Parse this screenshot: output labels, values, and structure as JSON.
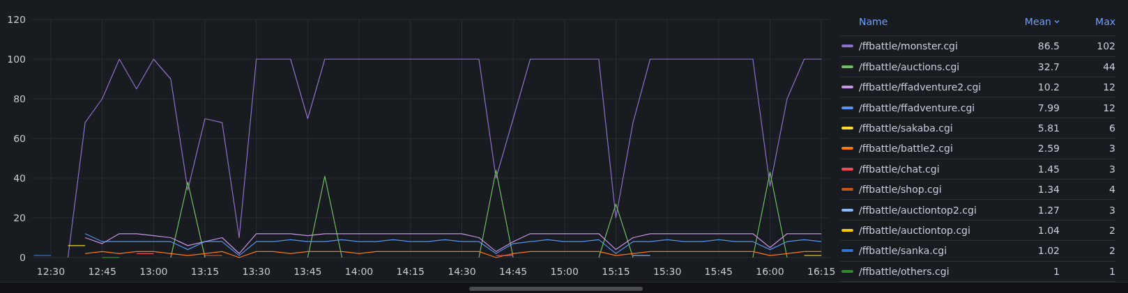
{
  "panel": {
    "chart_data": {
      "type": "line",
      "categories": [
        null,
        "12:30",
        null,
        null,
        "12:45",
        null,
        null,
        "13:00",
        null,
        null,
        "13:15",
        null,
        null,
        "13:30",
        null,
        null,
        "13:45",
        null,
        null,
        "14:00",
        null,
        null,
        "14:15",
        null,
        null,
        "14:30",
        null,
        null,
        "14:45",
        null,
        null,
        "15:00",
        null,
        null,
        "15:15",
        null,
        null,
        "15:30",
        null,
        null,
        "15:45",
        null,
        null,
        "16:00",
        null,
        null,
        "16:15"
      ],
      "ylim": [
        0,
        120
      ],
      "grid": true,
      "yticks": [
        0,
        20,
        40,
        60,
        80,
        100,
        120
      ],
      "series": [
        {
          "name": "/ffbattle/monster.cgi",
          "color": "#8f72c9",
          "values": [
            null,
            null,
            0,
            68,
            80,
            100,
            85,
            100,
            90,
            34,
            70,
            68,
            10,
            100,
            100,
            100,
            70,
            100,
            100,
            100,
            100,
            100,
            100,
            100,
            100,
            100,
            100,
            40,
            70,
            100,
            100,
            100,
            100,
            100,
            20,
            68,
            100,
            100,
            100,
            100,
            100,
            100,
            100,
            36,
            80,
            100,
            100
          ]
        },
        {
          "name": "/ffbattle/auctions.cgi",
          "color": "#73bf69",
          "values": [
            null,
            null,
            null,
            null,
            null,
            null,
            null,
            null,
            0,
            38,
            0,
            null,
            null,
            null,
            null,
            null,
            0,
            41,
            0,
            null,
            null,
            null,
            null,
            null,
            null,
            null,
            0,
            44,
            0,
            null,
            null,
            null,
            null,
            0,
            27,
            0,
            null,
            null,
            null,
            null,
            null,
            null,
            0,
            43,
            0,
            null,
            null
          ]
        },
        {
          "name": "/ffbattle/ffadventure2.cgi",
          "color": "#ca95e5",
          "values": [
            null,
            null,
            null,
            10,
            7,
            12,
            12,
            11,
            10,
            6,
            8,
            10,
            2,
            12,
            12,
            12,
            11,
            12,
            12,
            12,
            12,
            12,
            12,
            12,
            12,
            12,
            10,
            3,
            8,
            12,
            12,
            12,
            12,
            12,
            4,
            10,
            12,
            12,
            12,
            12,
            12,
            12,
            12,
            5,
            12,
            12,
            12
          ]
        },
        {
          "name": "/ffbattle/ffadventure.cgi",
          "color": "#5794f2",
          "values": [
            null,
            null,
            null,
            12,
            8,
            8,
            8,
            8,
            8,
            4,
            8,
            8,
            1,
            8,
            8,
            9,
            8,
            8,
            9,
            8,
            8,
            9,
            8,
            8,
            9,
            8,
            8,
            2,
            7,
            8,
            9,
            8,
            8,
            9,
            2,
            8,
            8,
            9,
            8,
            8,
            9,
            8,
            8,
            4,
            8,
            9,
            8
          ]
        },
        {
          "name": "/ffbattle/sakaba.cgi",
          "color": "#fade2a",
          "values": [
            null,
            null,
            6,
            6,
            null,
            null,
            null,
            null,
            null,
            null,
            null,
            null,
            null,
            null,
            null,
            null,
            null,
            null,
            null,
            null,
            null,
            null,
            null,
            null,
            null,
            null,
            null,
            null,
            null,
            null,
            null,
            null,
            null,
            null,
            null,
            null,
            null,
            null,
            null,
            null,
            null,
            null,
            null,
            null,
            null,
            null,
            null
          ]
        },
        {
          "name": "/ffbattle/battle2.cgi",
          "color": "#ff780a",
          "values": [
            null,
            null,
            null,
            2,
            3,
            2,
            3,
            3,
            2,
            1,
            2,
            3,
            0,
            3,
            3,
            2,
            3,
            3,
            3,
            2,
            3,
            3,
            3,
            3,
            3,
            3,
            3,
            0,
            2,
            3,
            3,
            3,
            3,
            3,
            1,
            2,
            3,
            3,
            3,
            3,
            3,
            3,
            3,
            1,
            2,
            3,
            3
          ]
        },
        {
          "name": "/ffbattle/chat.cgi",
          "color": "#f2495c",
          "values": [
            null,
            null,
            null,
            null,
            null,
            null,
            2,
            2,
            null,
            null,
            null,
            null,
            null,
            null,
            null,
            null,
            null,
            null,
            null,
            null,
            null,
            null,
            null,
            null,
            null,
            null,
            null,
            1,
            1,
            null,
            null,
            null,
            null,
            null,
            null,
            null,
            null,
            null,
            null,
            null,
            null,
            null,
            null,
            null,
            null,
            null,
            null
          ]
        },
        {
          "name": "/ffbattle/shop.cgi",
          "color": "#c4581b",
          "values": [
            null,
            null,
            null,
            null,
            null,
            null,
            null,
            null,
            null,
            null,
            1,
            1,
            null,
            null,
            null,
            null,
            null,
            null,
            null,
            null,
            null,
            null,
            null,
            null,
            null,
            null,
            null,
            null,
            null,
            null,
            null,
            null,
            null,
            null,
            null,
            null,
            null,
            null,
            null,
            null,
            null,
            null,
            null,
            null,
            null,
            null,
            null
          ]
        },
        {
          "name": "/ffbattle/auctiontop2.cgi",
          "color": "#8ab8ff",
          "values": [
            null,
            null,
            null,
            null,
            null,
            null,
            null,
            null,
            null,
            null,
            null,
            null,
            null,
            null,
            null,
            null,
            null,
            null,
            null,
            null,
            null,
            null,
            null,
            null,
            null,
            null,
            null,
            null,
            null,
            null,
            null,
            null,
            null,
            null,
            null,
            1,
            1,
            null,
            null,
            null,
            null,
            null,
            null,
            null,
            null,
            null,
            null
          ]
        },
        {
          "name": "/ffbattle/auctiontop.cgi",
          "color": "#f2cc0c",
          "values": [
            null,
            null,
            null,
            null,
            null,
            null,
            null,
            null,
            null,
            null,
            null,
            null,
            null,
            null,
            null,
            null,
            null,
            null,
            null,
            null,
            null,
            null,
            null,
            null,
            null,
            null,
            null,
            null,
            null,
            null,
            null,
            null,
            null,
            null,
            null,
            null,
            null,
            null,
            null,
            null,
            null,
            null,
            null,
            null,
            null,
            1,
            1
          ]
        },
        {
          "name": "/ffbattle/sanka.cgi",
          "color": "#3274d9",
          "values": [
            1,
            1,
            null,
            null,
            null,
            null,
            null,
            null,
            null,
            null,
            null,
            null,
            null,
            null,
            null,
            null,
            null,
            null,
            null,
            null,
            null,
            null,
            null,
            null,
            null,
            null,
            null,
            null,
            null,
            null,
            null,
            null,
            null,
            null,
            null,
            null,
            null,
            null,
            null,
            null,
            null,
            null,
            null,
            null,
            null,
            null,
            null
          ]
        },
        {
          "name": "/ffbattle/others.cgi",
          "color": "#37872d",
          "values": [
            null,
            null,
            null,
            null,
            0,
            0,
            null,
            null,
            null,
            null,
            null,
            null,
            null,
            null,
            null,
            null,
            null,
            null,
            null,
            null,
            null,
            null,
            null,
            null,
            null,
            null,
            null,
            null,
            null,
            null,
            null,
            null,
            null,
            null,
            null,
            null,
            null,
            null,
            null,
            null,
            null,
            null,
            null,
            null,
            null,
            null,
            null
          ]
        }
      ]
    }
  },
  "legend": {
    "columns": [
      {
        "label": "Name",
        "sorted": false
      },
      {
        "label": "Mean",
        "sorted": true
      },
      {
        "label": "Max",
        "sorted": false
      }
    ],
    "rows": [
      {
        "mean": "86.5",
        "max": "102"
      },
      {
        "mean": "32.7",
        "max": "44"
      },
      {
        "mean": "10.2",
        "max": "12"
      },
      {
        "mean": "7.99",
        "max": "12"
      },
      {
        "mean": "5.81",
        "max": "6"
      },
      {
        "mean": "2.59",
        "max": "3"
      },
      {
        "mean": "1.45",
        "max": "3"
      },
      {
        "mean": "1.34",
        "max": "4"
      },
      {
        "mean": "1.27",
        "max": "3"
      },
      {
        "mean": "1.04",
        "max": "2"
      },
      {
        "mean": "1.02",
        "max": "2"
      },
      {
        "mean": "1",
        "max": "1"
      }
    ]
  }
}
